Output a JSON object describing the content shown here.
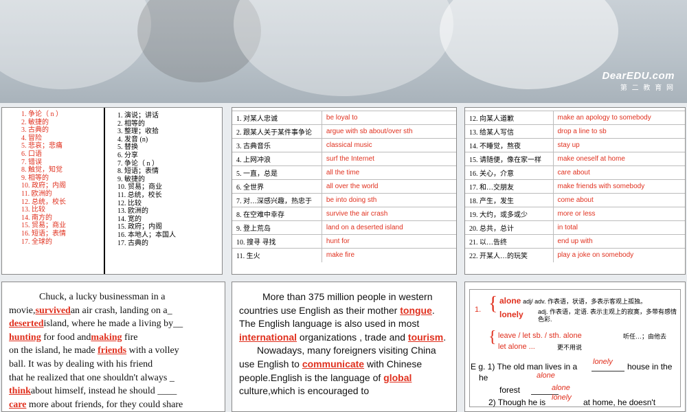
{
  "header": {
    "logo_main": "DearEDU.com",
    "logo_sub": "第 二 教 育 网"
  },
  "slide1": {
    "left_items": [
      "1. 争论（ n ）",
      "2. 敏捷的",
      "3. 古典的",
      "4. 冒险",
      "5. 悲哀；悲痛",
      "6. 口语",
      "7. 错误",
      "8. 触觉，知觉",
      "9. 相等的",
      "10. 政府；内阁",
      "11. 欧洲的",
      "12. 总统，校长",
      "13. 比较",
      "14. 南方的",
      "15. 贸易；商业",
      "16. 短语；表情",
      "17. 全球的"
    ],
    "right_items": [
      "1. 演说；讲话",
      "2. 相等的",
      "3. 整理；收拾",
      "4. 发音 (n)",
      "5. 替换",
      "6. 分享",
      "7. 争论（ n ）",
      "8. 短语；表情",
      "9. 敏捷的",
      "10. 贸易；商业",
      "11. 总统，校长",
      "12. 比较",
      "13. 欧洲的",
      "14. 宽的",
      "15. 政府；内阁",
      "16. 本地人；本国人",
      "17. 古典的"
    ]
  },
  "slide2": {
    "rows": [
      {
        "cn": "1. 对某人忠诚",
        "en": "be loyal to"
      },
      {
        "cn": "2. 跟某人关于某件事争论",
        "en": "argue with sb about/over sth"
      },
      {
        "cn": "3. 古典音乐",
        "en": "classical music"
      },
      {
        "cn": "4. 上网冲浪",
        "en": "surf the Internet"
      },
      {
        "cn": "5. 一直，总是",
        "en": "all the time"
      },
      {
        "cn": "6. 全世界",
        "en": "all over the world"
      },
      {
        "cn": "7. 对…深感兴趣，热忠于",
        "en": "be into doing sth"
      },
      {
        "cn": "8. 在空难中幸存",
        "en": "survive the air crash"
      },
      {
        "cn": "9. 登上荒岛",
        "en": "land on  a deserted island"
      },
      {
        "cn": "10. 搜寻  寻找",
        "en": "hunt for"
      },
      {
        "cn": "11. 生火",
        "en": "make fire"
      }
    ]
  },
  "slide3": {
    "rows": [
      {
        "cn": "12. 向某人道歉",
        "en": "make an apology to somebody"
      },
      {
        "cn": "13. 给某人写信",
        "en": "drop  a line to sb"
      },
      {
        "cn": "14. 不睡觉，熬夜",
        "en": "stay up"
      },
      {
        "cn": "15. 请随便，像在家一样",
        "en": "make oneself at home"
      },
      {
        "cn": "16. 关心，介意",
        "en": "care about"
      },
      {
        "cn": "17. 和…交朋友",
        "en": "make friends with somebody"
      },
      {
        "cn": "18. 产生，发生",
        "en": "come about"
      },
      {
        "cn": "19. 大约，或多或少",
        "en": "more or less"
      },
      {
        "cn": "20. 总共，总计",
        "en": "in total"
      },
      {
        "cn": "21. 以…告终",
        "en": "end up with"
      },
      {
        "cn": "22. 开某人…的玩笑",
        "en": "play a joke on somebody"
      }
    ]
  },
  "slide4": {
    "lines": [
      "Chuck, a lucky businessman in a",
      "movie,",
      "an air crash, landing on   a_",
      "island, where he made a living by__",
      "for food and",
      "fire",
      "on the island,  he made",
      "with a volley",
      "ball. It was by dealing with his friend",
      "that he realized that one shouldn't always _",
      "about himself,  instead he should ____",
      "more about friends, for they could share"
    ],
    "answers": [
      "survived",
      "deserted",
      "hunting",
      "making",
      "friends",
      "think",
      "care"
    ]
  },
  "slide5": {
    "p1": "More than 375 million people in western countries use English as their mother",
    "p1b": "The English language is also used  in most",
    "p1c": "organizations , trade and",
    "p2": "Nowadays, many foreigners visiting China use English to",
    "p2b": "with Chinese people.English is the language  of",
    "p2c": "culture,which is encouraged   to",
    "answers": [
      "tongue",
      "international",
      "tourism",
      "communicate",
      "global"
    ]
  },
  "slide6": {
    "num": "1.",
    "alone": "alone",
    "alone_desc": "adj/ adv.  作表语，状语，多表示客观上孤独。",
    "lonely": "lonely",
    "lonely_desc": "adj.  作表语，定语.  表示主观上的寂寞，多带有感情色彩.",
    "phrase1": "leave / let sb. / sth. alone",
    "phrase1_cn": "听任…；由他去",
    "phrase2": "let alone ...",
    "phrase2_cn": "更不用说",
    "eg1": "E g. 1) The old man lives in a",
    "eg1b": "house in the",
    "eg1_ans1": "lonely",
    "eg1_ans2": "alone",
    "forest": "forest",
    "forest_ans": "alone",
    "eg2": "2) Though he is",
    "eg2b": "at home, he doesn't",
    "eg2_ans": "lonely"
  }
}
